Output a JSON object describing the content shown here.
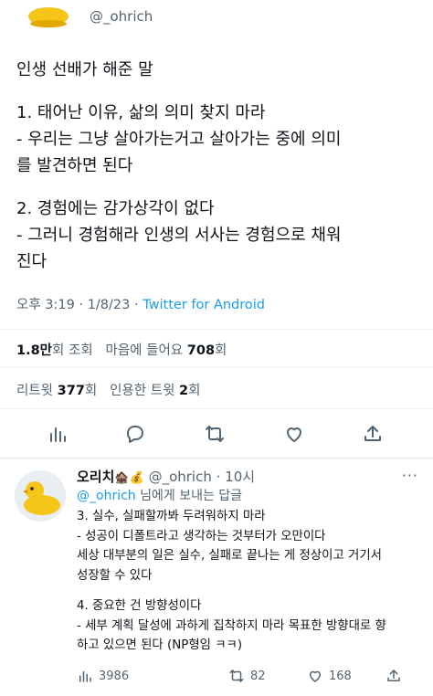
{
  "top_author": {
    "handle": "@_ohrich",
    "avatar_icon": "duck-avatar-icon"
  },
  "tweet": {
    "title": "인생 선배가 해준 말",
    "point1_title": "1. 태어난 이유, 삶의 의미 찾지 마라",
    "point1_body_line1": "- 우리는 그냥 살아가는거고 살아가는 중에 의미",
    "point1_body_line2": "를 발견하면 된다",
    "point2_title": "2. 경험에는 감가상각이 없다",
    "point2_body_line1": "- 그러니 경험해라 인생의 서사는 경험으로 채워",
    "point2_body_line2": "진다"
  },
  "meta": {
    "time": "오후 3:19",
    "date": "1/8/23",
    "source": "Twitter for Android"
  },
  "stats": {
    "views_value": "1.8만",
    "views_label": "회 조회",
    "likes_prefix": "마음에 들어요",
    "likes_value": "708",
    "likes_suffix": "회",
    "retweets_prefix": "리트윗",
    "retweets_value": "377",
    "retweets_suffix": "회",
    "quotes_prefix": "인용한 트윗",
    "quotes_value": "2",
    "quotes_suffix": "회"
  },
  "actions": [
    "analytics-icon",
    "reply-icon",
    "retweet-icon",
    "like-icon",
    "share-icon"
  ],
  "reply": {
    "name": "오리치",
    "name_emoji": "🏚️💰",
    "handle": "@_ohrich",
    "time": "· 10시",
    "reply_to_mention": "@_ohrich",
    "reply_to_text": " 님에게 보내는 답글",
    "line1": "3. 실수, 실패할까봐 두려워하지 마라",
    "line2": "- 성공이 디폴트라고 생각하는 것부터가 오만이다",
    "line3": "세상 대부분의 일은 실수, 실패로 끝나는 게 정상이고 거기서",
    "line4": "성장할 수 있다",
    "line5": "4. 중요한 건 방향성이다",
    "line6": "- 세부 계획 달성에 과하게 집착하지 마라 목표한 방향대로 향",
    "line7": "하고 있으면 된다 (NP형임 ㅋㅋ)",
    "views": "3986",
    "retweets": "82",
    "likes": "168"
  },
  "colors": {
    "accent": "#1d9bf0",
    "secondary": "#536471",
    "text": "#0f1419",
    "divider": "#eff3f4",
    "duck": "#f5c518"
  }
}
